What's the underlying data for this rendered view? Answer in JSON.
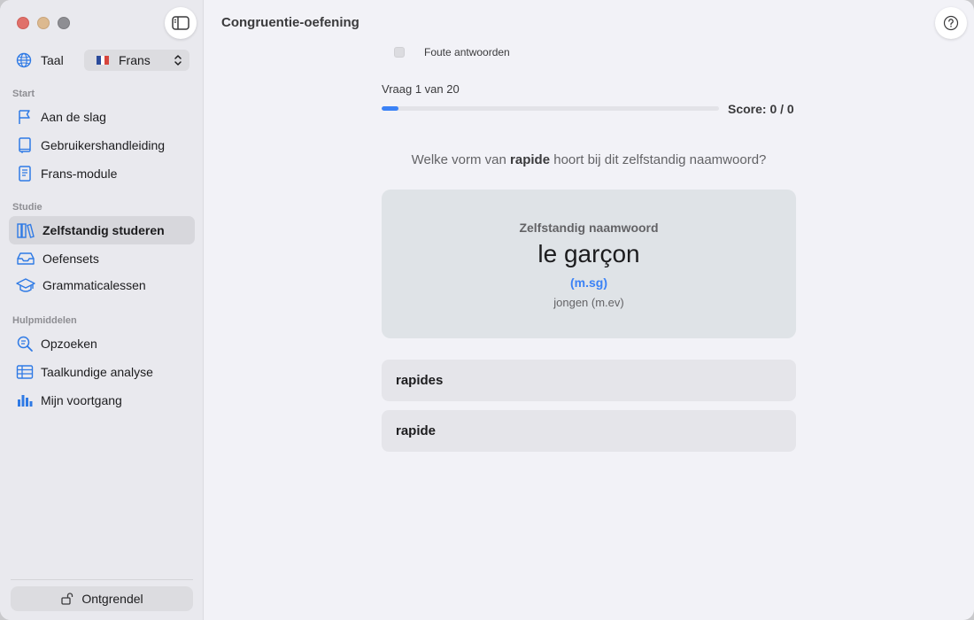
{
  "window": {
    "title": "Congruentie-oefening"
  },
  "sidebar": {
    "language_label": "Taal",
    "language_value": "Frans",
    "sections": {
      "start": "Start",
      "study": "Studie",
      "tools": "Hulpmiddelen"
    },
    "items": [
      {
        "label": "Aan de slag",
        "icon": "flag-icon"
      },
      {
        "label": "Gebruikershandleiding",
        "icon": "book-icon"
      },
      {
        "label": "Frans-module",
        "icon": "document-icon"
      },
      {
        "label": "Zelfstandig studeren",
        "icon": "books-icon",
        "active": true
      },
      {
        "label": "Oefensets",
        "icon": "tray-icon"
      },
      {
        "label": "Grammaticalessen",
        "icon": "graduation-cap-icon"
      },
      {
        "label": "Opzoeken",
        "icon": "search-icon"
      },
      {
        "label": "Taalkundige analyse",
        "icon": "table-icon"
      },
      {
        "label": "Mijn voortgang",
        "icon": "bar-chart-icon"
      }
    ],
    "unlock_label": "Ontgrendel"
  },
  "exercise": {
    "wrong_answers_label": "Foute antwoorden",
    "progress_text": "Vraag 1 van 20",
    "progress_fraction": 0.05,
    "score_text": "Score: 0 / 0",
    "question_prefix": "Welke vorm van",
    "question_word": "rapide",
    "question_suffix": "hoort bij dit zelfstandig naamwoord?",
    "card": {
      "type": "Zelfstandig naamwoord",
      "word": "le garçon",
      "grammar": "(m.sg)",
      "translation": "jongen (m.ev)"
    },
    "answers": [
      "rapides",
      "rapide"
    ]
  },
  "colors": {
    "accent": "#3b82f6",
    "sidebar_bg": "#e9e9ee",
    "main_bg": "#f2f2f7",
    "card_bg": "#dfe3e7"
  }
}
